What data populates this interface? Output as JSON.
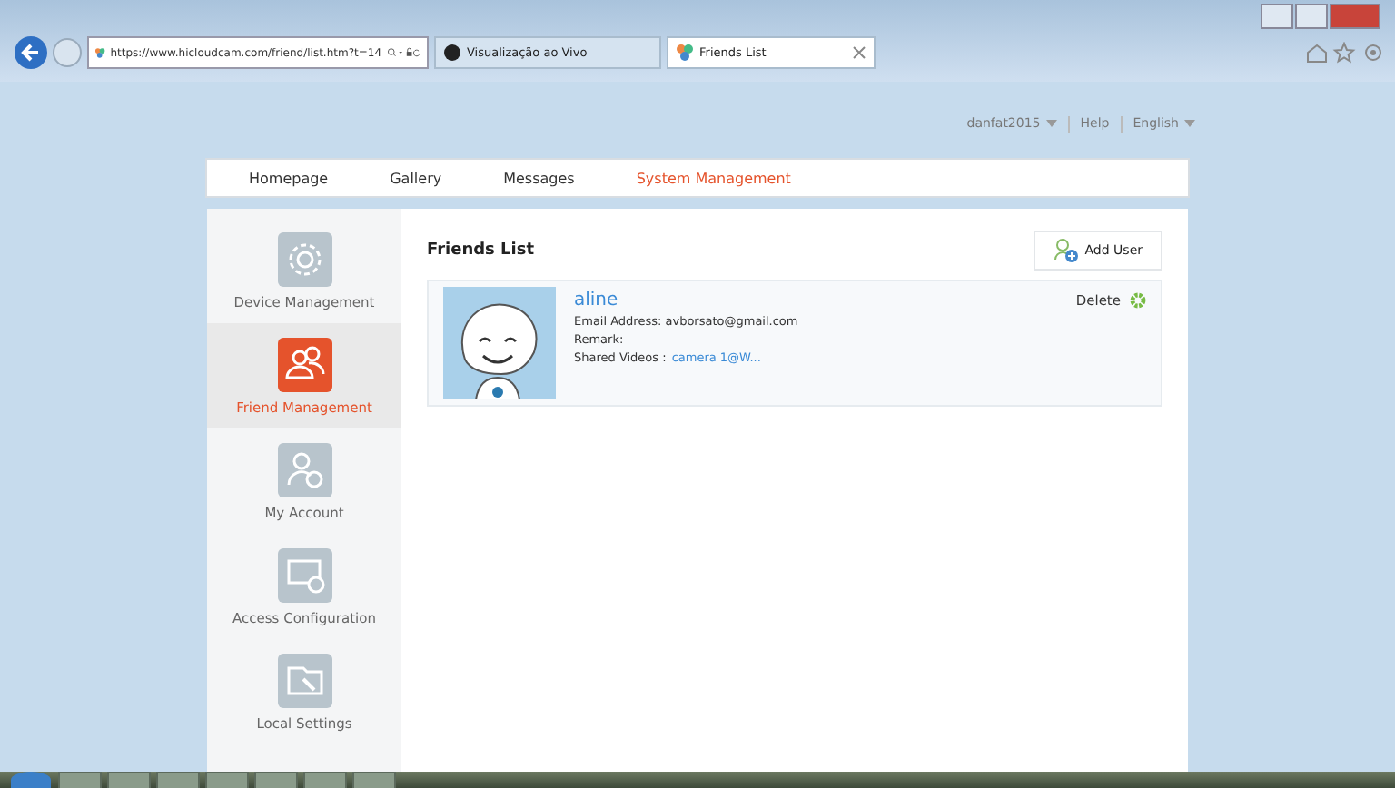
{
  "browser": {
    "address": "https://www.hicloudcam.com/friend/list.htm?t=14",
    "tabs": [
      {
        "label": "Visualização ao Vivo",
        "selected": false
      },
      {
        "label": "Friends List",
        "selected": true
      }
    ]
  },
  "user_menu": [
    {
      "label": "danfat2015",
      "dropdown": true
    },
    {
      "label": "Help",
      "dropdown": false
    },
    {
      "label": "English",
      "dropdown": true
    }
  ],
  "nav": [
    {
      "label": "Homepage",
      "selected": false
    },
    {
      "label": "Gallery",
      "selected": false
    },
    {
      "label": "Messages",
      "selected": false
    },
    {
      "label": "System Management",
      "selected": true
    }
  ],
  "sidebar": [
    {
      "label": "Device Management",
      "kind": "gear",
      "selected": false
    },
    {
      "label": "Friend Management",
      "kind": "friends",
      "selected": true
    },
    {
      "label": "My Account",
      "kind": "account",
      "selected": false
    },
    {
      "label": "Access Configuration",
      "kind": "access",
      "selected": false
    },
    {
      "label": "Local Settings",
      "kind": "settings",
      "selected": false
    }
  ],
  "content": {
    "title": "Friends List",
    "add_button": "Add User",
    "friends": [
      {
        "name": "aline",
        "email_label": "Email Address:",
        "email": "avborsato@gmail.com",
        "remark_label": "Remark:",
        "shared_label": "Shared Videos :",
        "shared_link": "camera 1@W...",
        "delete": "Delete"
      }
    ]
  }
}
